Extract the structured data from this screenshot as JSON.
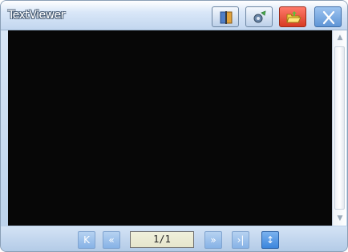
{
  "window": {
    "title": "TextViewer"
  },
  "titlebar": {
    "buttons": [
      {
        "icon": "book-icon"
      },
      {
        "icon": "settings-icon"
      },
      {
        "icon": "folder-open-icon"
      },
      {
        "icon": "close-icon"
      }
    ]
  },
  "navigation": {
    "first_label": "K",
    "prev_label": "«",
    "page_indicator": "1/1",
    "next_label": "»",
    "last_label": "›|",
    "scroll_mode_label": "↕"
  },
  "colors": {
    "content_background": "#070707",
    "accent_blue": "#3c86dd",
    "folder_button_red": "#d73a22"
  }
}
